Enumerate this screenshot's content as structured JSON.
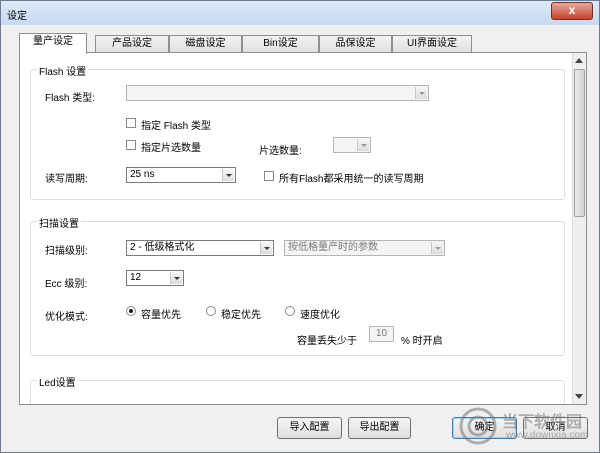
{
  "window": {
    "title": "设定",
    "close_label": "x"
  },
  "tabs": [
    "量产设定",
    "产品设定",
    "磁盘设定",
    "Bin设定",
    "品保设定",
    "UI界面设定"
  ],
  "flash_group": {
    "title": "Flash 设置",
    "type_label": "Flash 类型:",
    "type_value": "",
    "chk_specify_type": "指定 Flash 类型",
    "chk_specify_ce": "指定片选数量",
    "ce_count_label": "片选数量:",
    "ce_count_value": "",
    "rw_cycle_label": "读写周期:",
    "rw_cycle_value": "25 ns",
    "chk_uniform_cycle": "所有Flash都采用统一的读写周期"
  },
  "scan_group": {
    "title": "扫描设置",
    "level_label": "扫描级别:",
    "level_value": "2 - 低级格式化",
    "param_value": "按低格量产时的参数",
    "ecc_label": "Ecc 级别:",
    "ecc_value": "12",
    "opt_label": "优化模式:",
    "opt_capacity": "容量优先",
    "opt_stable": "稳定优先",
    "opt_speed": "速度优化",
    "capacity_loss_label": "容量丢失少于",
    "capacity_loss_value": "10",
    "capacity_loss_suffix": "% 时开启"
  },
  "led_group": {
    "title": "Led设置"
  },
  "buttons": {
    "import": "导入配置",
    "export": "导出配置",
    "ok": "确定",
    "cancel": "取消"
  },
  "watermark": {
    "site": "当下软件园",
    "url": "www.downxia.com"
  }
}
